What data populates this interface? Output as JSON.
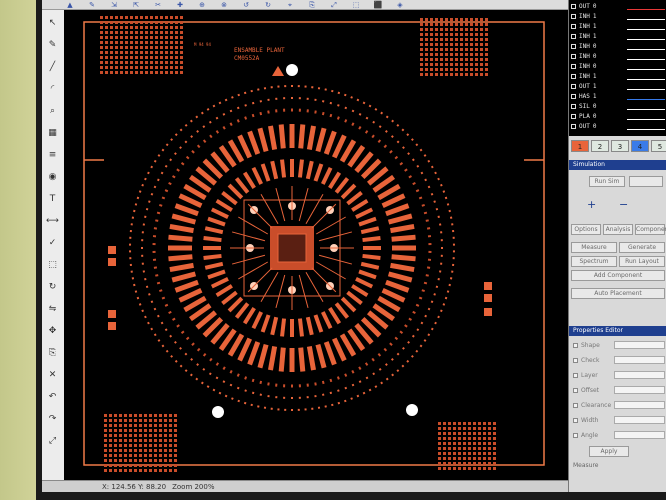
{
  "toolbar": {
    "items": [
      "▲",
      "✎",
      "⇲",
      "⇱",
      "✂",
      "✚",
      "⊕",
      "⊗",
      "↺",
      "↻",
      "⌖",
      "⎘",
      "⤢",
      "⬚",
      "⬛",
      "◈"
    ]
  },
  "left_toolbar": {
    "icons": [
      "pointer-icon",
      "pen-icon",
      "line-icon",
      "arc-icon",
      "zoom-icon",
      "grid-icon",
      "layer-icon",
      "via-icon",
      "text-icon",
      "measure-icon",
      "drc-icon",
      "select-icon",
      "rotate-icon",
      "flip-icon",
      "move-icon",
      "copy-icon",
      "delete-icon",
      "undo-icon",
      "redo-icon",
      "fit-icon"
    ]
  },
  "board": {
    "label_line1": "ENSAMBLE PLANT",
    "label_line2": "CM0552A",
    "small_label": "M 94 94",
    "colors": {
      "copper": "#e8643a",
      "copper_dark": "#c94d2a",
      "background": "#000000",
      "outline": "#f07a48",
      "hole": "#ffffff"
    }
  },
  "signals": [
    {
      "name": "OUT",
      "val": "0",
      "wave": "#e83a3a"
    },
    {
      "name": "INH",
      "val": "1",
      "wave": "#ffffff"
    },
    {
      "name": "INH",
      "val": "1",
      "wave": "#ffffff"
    },
    {
      "name": "INH",
      "val": "1",
      "wave": "#ffffff"
    },
    {
      "name": "INH",
      "val": "0",
      "wave": "#ffffff"
    },
    {
      "name": "INH",
      "val": "0",
      "wave": "#ffffff"
    },
    {
      "name": "INH",
      "val": "0",
      "wave": "#ffffff"
    },
    {
      "name": "INH",
      "val": "1",
      "wave": "#ffffff"
    },
    {
      "name": "OUT",
      "val": "1",
      "wave": "#ffffff"
    },
    {
      "name": "HAS",
      "val": "1",
      "wave": "#3a7be8"
    },
    {
      "name": "SIL",
      "val": "0",
      "wave": "#ffffff"
    },
    {
      "name": "PLA",
      "val": "0",
      "wave": "#ffffff"
    },
    {
      "name": "OUT",
      "val": "0",
      "wave": "#ffffff"
    }
  ],
  "tabs": [
    {
      "label": "1",
      "color": "#e8643a"
    },
    {
      "label": "2",
      "color": "#dfe8e0"
    },
    {
      "label": "3",
      "color": "#dfe8e0"
    },
    {
      "label": "4",
      "color": "#3a7be8"
    },
    {
      "label": "5",
      "color": "#dfe8e0"
    }
  ],
  "panel": {
    "title_1": "Simulation",
    "btn_run": "Run Sim",
    "plus": "+",
    "minus": "−",
    "row_btns": [
      "Options",
      "Analysis",
      "Components"
    ],
    "btn_grid": [
      "Measure",
      "Generate",
      "Spectrum",
      "Run Layout"
    ],
    "btn_single_1": "Add Component",
    "btn_single_2": "Auto Placement",
    "title_2": "Properties Editor",
    "opts": [
      "Shape",
      "Check",
      "Layer",
      "Offset",
      "Clearance",
      "Width",
      "Angle"
    ],
    "btn_apply": "Apply",
    "footer": "Measure"
  },
  "status": {
    "coords": "X: 124.56  Y: 88.20",
    "zoom": "Zoom 200%"
  }
}
